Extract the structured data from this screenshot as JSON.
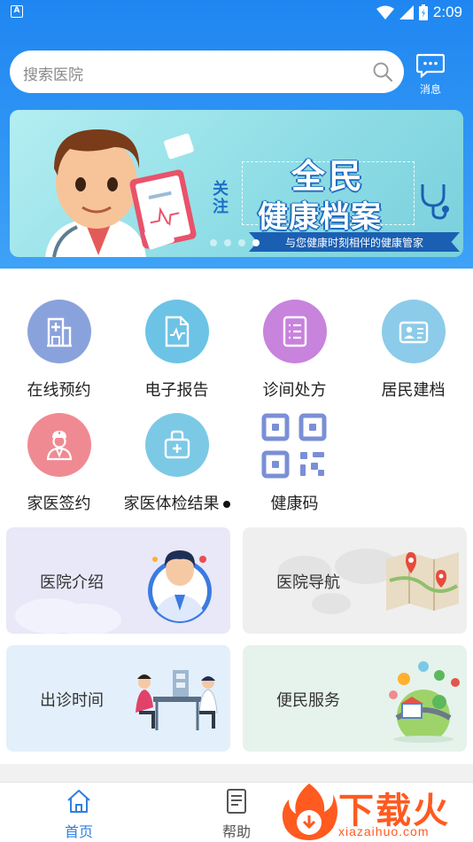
{
  "status_bar": {
    "time": "2:09"
  },
  "search": {
    "placeholder": "搜索医院"
  },
  "message_button": {
    "label": "消息"
  },
  "banner": {
    "side_text": "关注",
    "title_line1": "全民",
    "title_line2": "健康档案",
    "subtitle": "与您健康时刻相伴的健康管家",
    "slide_count": 4,
    "active_slide": 4
  },
  "grid": {
    "items": [
      {
        "label": "在线预约",
        "icon": "hospital-building-icon",
        "color": "#8aa2dc"
      },
      {
        "label": "电子报告",
        "icon": "report-document-icon",
        "color": "#6cc3e6"
      },
      {
        "label": "诊间处方",
        "icon": "prescription-list-icon",
        "color": "#c883dd"
      },
      {
        "label": "居民建档",
        "icon": "id-card-icon",
        "color": "#8ccbe9"
      },
      {
        "label": "家医签约",
        "icon": "doctor-avatar-icon",
        "color": "#f08a92"
      },
      {
        "label": "家医体检结果",
        "icon": "medical-kit-icon",
        "color": "#7cc9e6"
      },
      {
        "label": "健康码",
        "icon": "qr-code-icon",
        "color": "#7a8fd6"
      }
    ]
  },
  "cards": [
    {
      "label": "医院介绍",
      "bg": "#e8e8f8"
    },
    {
      "label": "医院导航",
      "bg": "#efefef"
    },
    {
      "label": "出诊时间",
      "bg": "#e3f0fb"
    },
    {
      "label": "便民服务",
      "bg": "#e6f3ec"
    }
  ],
  "tabs": [
    {
      "label": "首页",
      "active": true,
      "icon": "home-icon"
    },
    {
      "label": "帮助",
      "active": false,
      "icon": "help-document-icon"
    }
  ],
  "watermark": {
    "text": "下载火",
    "url": "xiazaihuo.com"
  },
  "colors": {
    "primary": "#1f86f1",
    "tab_active": "#2f7fe0",
    "tab_inactive": "#555555"
  }
}
